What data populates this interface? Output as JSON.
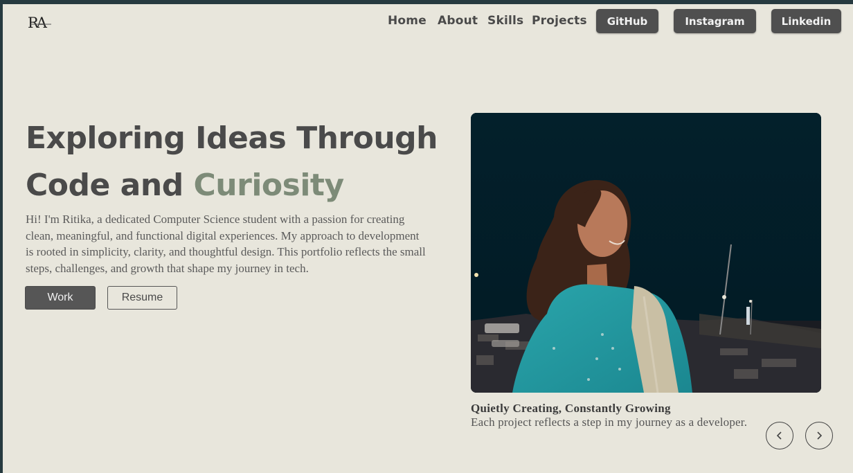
{
  "brand": {
    "logo_text": "RA"
  },
  "nav": {
    "links": [
      "Home",
      "About",
      "Skills",
      "Projects"
    ],
    "buttons": [
      "GitHub",
      "Instagram",
      "Linkedin"
    ]
  },
  "hero": {
    "headline_main": "Exploring Ideas Through Code and ",
    "headline_accent": "Curiosity",
    "intro": "Hi! I'm Ritika, a dedicated Computer Science student with a passion for creating clean, meaningful, and functional digital experiences. My approach to development is rooted in simplicity, clarity, and thoughtful design. This portfolio reflects the small steps, challenges, and growth that shape my journey in tech.",
    "work_label": "Work",
    "resume_label": "Resume"
  },
  "showcase": {
    "caption_title": "Quietly Creating, Constantly Growing",
    "caption_text": "Each project reflects a step in my journey as a developer."
  },
  "colors": {
    "background": "#e8e6dc",
    "text": "#4a4a4a",
    "accent": "#7d8b78",
    "button": "#4f4f4f"
  }
}
